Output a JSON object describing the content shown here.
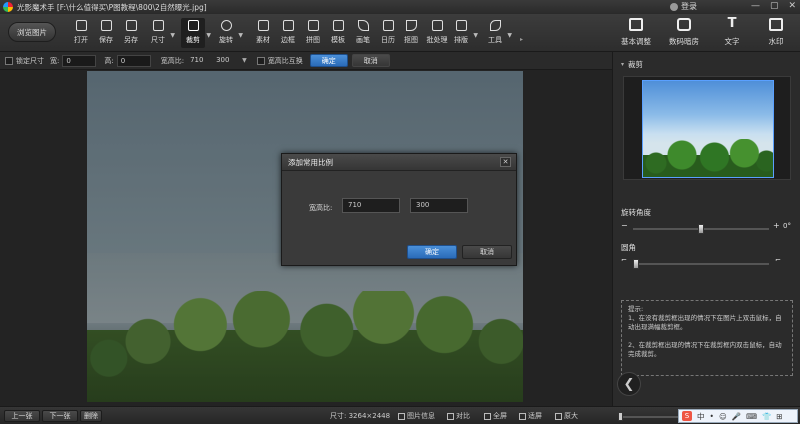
{
  "titlebar": {
    "title": "光影魔术手 [F:\\什么值得买\\P图教程\\800\\2自然曝光.jpg]",
    "login": "登录",
    "minimize": "—",
    "restore": "▢",
    "close": "✕"
  },
  "toolbar": {
    "browse": "浏览图片",
    "tools": [
      "打开",
      "保存",
      "另存",
      "尺寸",
      "裁剪",
      "旋转",
      "素材",
      "边框",
      "拼图",
      "模板",
      "画笔",
      "日历",
      "抠图",
      "批处理",
      "排版",
      "工具"
    ],
    "active_tool": "裁剪",
    "more": "▸"
  },
  "right_toolbar": {
    "tools": [
      "基本调整",
      "数码暗房",
      "文字",
      "水印"
    ]
  },
  "options": {
    "lock_size": "锁定尺寸",
    "width_label": "宽:",
    "width_value": "0",
    "height_label": "高:",
    "height_value": "0",
    "ratio_label": "宽高比:",
    "ratio_w": "710",
    "ratio_h": "300",
    "swap": "宽高比互换",
    "confirm": "确定",
    "cancel": "取消"
  },
  "dialog": {
    "title": "添加常用比例",
    "close": "✕",
    "label": "宽高比:",
    "value_w": "710",
    "value_h": "300",
    "ok": "确定",
    "cancel": "取消"
  },
  "panel": {
    "section_crop": "裁剪",
    "rotate_label": "旋转角度",
    "rotate_value": "0°",
    "round_label": "圆角",
    "tip": "提示:\n1、在没有裁剪框出现的情况下在图片上双击鼠标，自动出现满幅裁剪框。\n\n2、在裁剪框出现的情况下在裁剪框内双击鼠标，自动完成裁剪。",
    "collapse": "❮"
  },
  "bottom": {
    "prev": "上一张",
    "next": "下一张",
    "delete": "删除",
    "size": "尺寸: 3264×2448",
    "info": "图片信息",
    "compare": "对比",
    "fullscreen": "全屏",
    "fit": "适屏",
    "original": "原大",
    "zoom_level": 0
  },
  "ime": {
    "logo": "S",
    "mode": "中",
    "punct": "•",
    "symbols": [
      "☺",
      "🎤",
      "⌨",
      "👕",
      "⊞"
    ]
  },
  "colors": {
    "accent_blue": "#2a6bb8",
    "selection_border": "#5aa0ff",
    "ime_logo": "#ee5544"
  }
}
